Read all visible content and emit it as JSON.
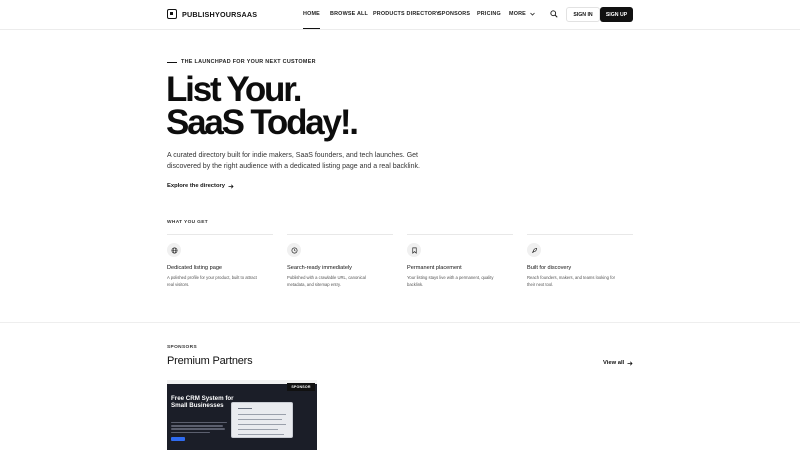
{
  "header": {
    "logo_text": "PUBLISHYOURSAAS",
    "nav": [
      {
        "label": "HOME",
        "active": true
      },
      {
        "label": "BROWSE ALL",
        "active": false
      },
      {
        "label": "PRODUCTS DIRECTORY",
        "active": false
      },
      {
        "label": "SPONSORS",
        "active": false
      },
      {
        "label": "PRICING",
        "active": false
      },
      {
        "label": "MORE",
        "active": false
      }
    ],
    "signin_label": "SIGN IN",
    "signup_label": "SIGN UP"
  },
  "hero": {
    "eyebrow": "THE LAUNCHPAD FOR YOUR NEXT CUSTOMER",
    "title_line1": "List Your.",
    "title_line2": "SaaS Today!.",
    "description": "A curated directory built for indie makers, SaaS founders, and tech launches. Get discovered by the right audience with a dedicated listing page and a real backlink.",
    "explore_label": "Explore the directory"
  },
  "features": {
    "label": "WHAT YOU GET",
    "items": [
      {
        "icon": "globe-icon",
        "title": "Dedicated listing page",
        "desc": "A polished profile for your product, built to attract real visitors."
      },
      {
        "icon": "clock-icon",
        "title": "Search-ready immediately",
        "desc": "Published with a crawlable URL, canonical metadata, and sitemap entry."
      },
      {
        "icon": "bookmark-icon",
        "title": "Permanent placement",
        "desc": "Your listing stays live with a permanent, quality backlink."
      },
      {
        "icon": "rocket-icon",
        "title": "Built for discovery",
        "desc": "Reach founders, makers, and teams looking for their next tool."
      }
    ]
  },
  "sponsors": {
    "label": "SPONSORS",
    "title": "Premium Partners",
    "view_all_label": "View all",
    "card": {
      "badge": "SPONSOR",
      "headline": "Free CRM System for Small Businesses"
    }
  }
}
